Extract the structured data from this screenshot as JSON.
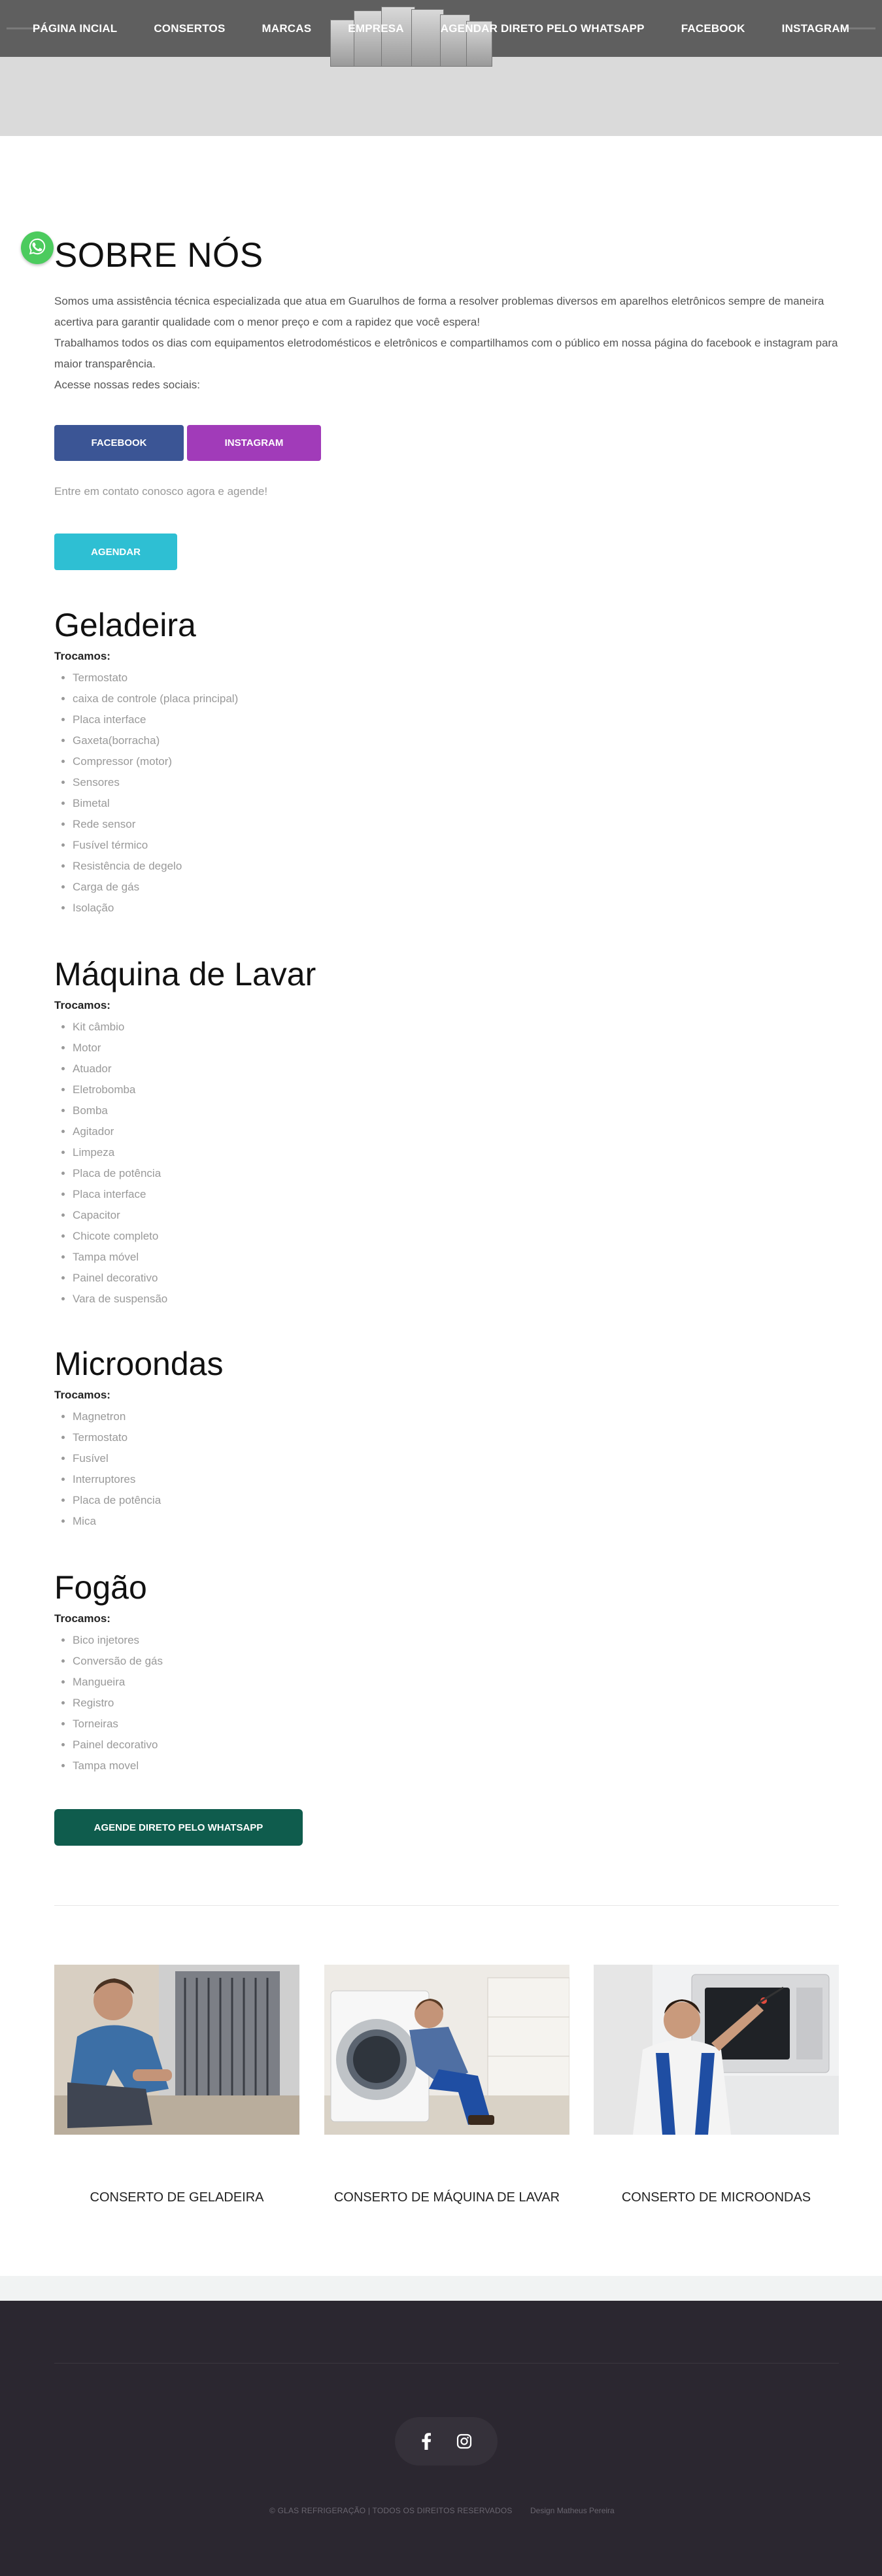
{
  "nav": {
    "items": [
      "PÁGINA INCIAL",
      "CONSERTOS",
      "MARCAS",
      "EMPRESA",
      "AGENDAR DIRETO PELO WHATSAPP",
      "FACEBOOK",
      "INSTAGRAM"
    ]
  },
  "about": {
    "title": "SOBRE NÓS",
    "p1": "Somos uma assistência técnica especializada que atua em Guarulhos de forma a resolver problemas diversos em aparelhos eletrônicos sempre de maneira acertiva para garantir qualidade com o menor preço e com a rapidez que você espera!",
    "p2": "Trabalhamos todos os dias com equipamentos eletrodomésticos e eletrônicos e compartilhamos com o público em nossa página do facebook e instagram para maior transparência.",
    "p3": "Acesse nossas redes sociais:",
    "facebook_label": "FACEBOOK",
    "instagram_label": "INSTAGRAM",
    "contact_text": "Entre em contato conosco agora e agende!",
    "schedule_label": "AGENDAR"
  },
  "services": [
    {
      "title": "Geladeira",
      "subtitle": "Trocamos:",
      "items": [
        "Termostato",
        "caixa de controle (placa principal)",
        "Placa interface",
        "Gaxeta(borracha)",
        "Compressor (motor)",
        "Sensores",
        "Bimetal",
        "Rede sensor",
        "Fusível térmico",
        "Resistência de degelo",
        "Carga de gás",
        "Isolação"
      ]
    },
    {
      "title": "Máquina de Lavar",
      "subtitle": "Trocamos:",
      "items": [
        "Kit câmbio",
        "Motor",
        "Atuador",
        "Eletrobomba",
        "Bomba",
        "Agitador",
        "Limpeza",
        "Placa de potência",
        "Placa interface",
        "Capacitor",
        "Chicote completo",
        "Tampa móvel",
        "Painel decorativo",
        "Vara de suspensão"
      ]
    },
    {
      "title": "Microondas",
      "subtitle": "Trocamos:",
      "items": [
        "Magnetron",
        "Termostato",
        "Fusível",
        "Interruptores",
        "Placa de potência",
        "Mica"
      ]
    },
    {
      "title": "Fogão",
      "subtitle": "Trocamos:",
      "items": [
        "Bico injetores",
        "Conversão de gás",
        "Mangueira",
        "Registro",
        "Torneiras",
        "Painel decorativo",
        "Tampa movel"
      ]
    }
  ],
  "whatsapp_cta": "AGENDE DIRETO PELO WHATSAPP",
  "cards": [
    {
      "caption": "CONSERTO DE GELADEIRA"
    },
    {
      "caption": "CONSERTO DE MÁQUINA DE LAVAR"
    },
    {
      "caption": "CONSERTO DE MICROONDAS"
    }
  ],
  "footer": {
    "copyright": "© GLAS REFRIGERAÇÃO | TODOS OS DIREITOS RESERVADOS",
    "design": "Design Matheus Pereira"
  },
  "icons": {
    "whatsapp": "whatsapp-icon",
    "facebook": "facebook-icon",
    "instagram": "instagram-icon"
  },
  "colors": {
    "facebook": "#3b5595",
    "instagram": "#a13bb9",
    "agendar": "#2ebfd3",
    "whatsapp_cta": "#0f5c4d",
    "footer": "#2b2730"
  }
}
